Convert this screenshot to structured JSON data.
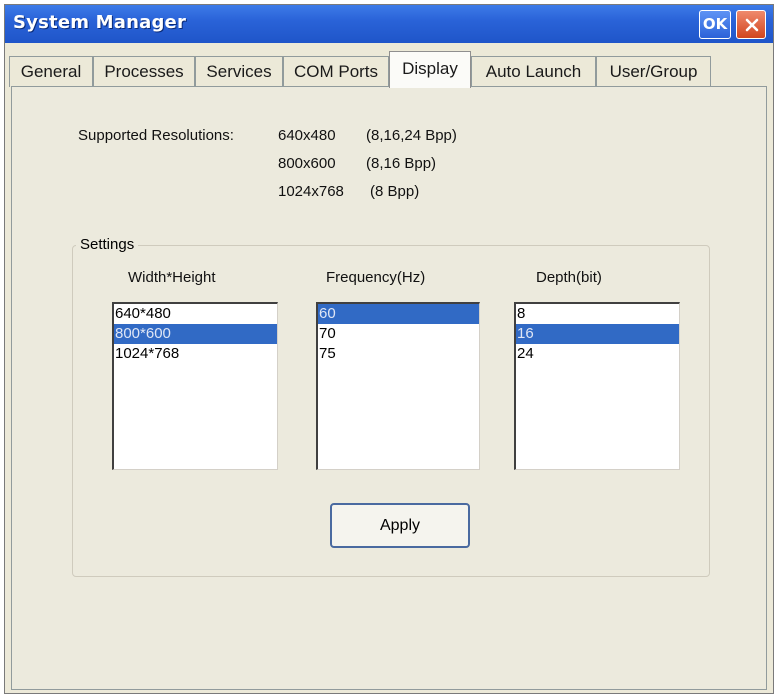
{
  "window": {
    "title": "System Manager",
    "ok_label": "OK"
  },
  "tabs": [
    {
      "label": "General"
    },
    {
      "label": "Processes"
    },
    {
      "label": "Services"
    },
    {
      "label": "COM Ports"
    },
    {
      "label": "Display",
      "active": true
    },
    {
      "label": "Auto Launch"
    },
    {
      "label": "User/Group"
    }
  ],
  "supported": {
    "label": "Supported Resolutions:",
    "rows": [
      {
        "res": "640x480",
        "bpp": "(8,16,24 Bpp)"
      },
      {
        "res": "800x600",
        "bpp": "(8,16 Bpp)"
      },
      {
        "res": "1024x768",
        "bpp": "(8 Bpp)"
      }
    ]
  },
  "settings": {
    "legend": "Settings",
    "width_height": {
      "header": "Width*Height",
      "items": [
        "640*480",
        "800*600",
        "1024*768"
      ],
      "selected": "800*600"
    },
    "frequency": {
      "header": "Frequency(Hz)",
      "items": [
        "60",
        "70",
        "75"
      ],
      "selected": "60"
    },
    "depth": {
      "header": "Depth(bit)",
      "items": [
        "8",
        "16",
        "24"
      ],
      "selected": "16"
    },
    "apply_label": "Apply"
  },
  "colors": {
    "titlebar": "#2a63d8",
    "selection": "#316ac5",
    "face": "#ece9d8",
    "close": "#d2451f"
  }
}
